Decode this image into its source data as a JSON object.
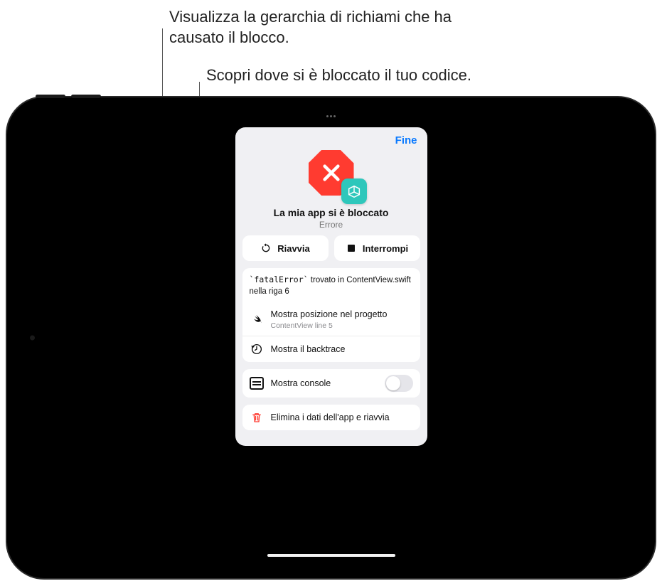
{
  "callouts": {
    "backtrace": "Visualizza la gerarchia di richiami che ha causato il blocco.",
    "position": "Scopri dove si è bloccato il tuo codice."
  },
  "sheet": {
    "done": "Fine",
    "title": "La mia app si è bloccato",
    "subtitle": "Errore",
    "restart": "Riavvia",
    "stop": "Interrompi",
    "error_prefix": "`fatalError`",
    "error_rest": " trovato in ContentView.swift nella riga 6",
    "show_position": "Mostra posizione nel progetto",
    "show_position_sub": "ContentView line 5",
    "show_backtrace": "Mostra il backtrace",
    "show_console": "Mostra console",
    "delete_restart": "Elimina i dati dell'app e riavvia"
  }
}
